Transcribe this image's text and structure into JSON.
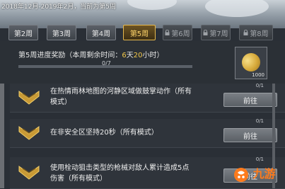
{
  "header": {
    "season_text": "2018年12月-2019年2月，当前为第5周"
  },
  "tabs": [
    {
      "label": "第2周",
      "state": "normal"
    },
    {
      "label": "第3周",
      "state": "normal"
    },
    {
      "label": "第4周",
      "state": "normal"
    },
    {
      "label": "第5周",
      "state": "active"
    },
    {
      "label": "第6周",
      "state": "locked"
    },
    {
      "label": "第7周",
      "state": "locked"
    },
    {
      "label": "第8周",
      "state": "locked"
    }
  ],
  "reward": {
    "title_prefix": "第5周进度奖励（本周剩余时间：",
    "days": "6",
    "days_unit": "天",
    "hours": "20",
    "hours_unit": "小时）",
    "progress_text": "0/7",
    "progress_fraction": 0,
    "coin_amount": "1000"
  },
  "tasks": [
    {
      "count": "0/1",
      "text": "在热情雨林地图的河静区域做鼓掌动作（所有模式）",
      "button": "前往"
    },
    {
      "count": "0/1",
      "text": "在非安全区坚持20秒（所有模式）",
      "button": "前往"
    },
    {
      "count": "0/1",
      "text": "使用栓动狙击类型的枪械对敌人累计造成5点伤害（所有模式）",
      "button": "前往"
    }
  ],
  "watermark": {
    "text": "九游"
  },
  "colors": {
    "accent": "#f2c84b",
    "active_tab_border": "#e6b94d",
    "watermark": "#ff7b1c"
  },
  "icons": {
    "tab_lock": "lock-icon",
    "task": "chevron-rank-icon",
    "reward": "coin-icon"
  }
}
